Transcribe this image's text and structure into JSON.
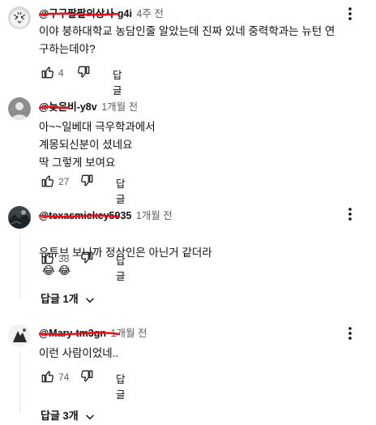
{
  "comments": [
    {
      "handle": "@구구팔팔의상사-g4i",
      "time": "4주 전",
      "text": "이야 붕하대학교 농담인줄 알았는데 진짜 있네 중력학과는 뉴턴 연\n구하는데야?",
      "likes": "4",
      "reply_label": "답글",
      "avatar_icon": "white-tiger-avatar"
    },
    {
      "handle": "@늦은비-y8v",
      "time": "1개월 전",
      "text": "아~~일베대 극우학과에서\n계몽되신분이 셨네요\n딱 그렇게 보여요",
      "likes": "27",
      "reply_label": "답글",
      "avatar_icon": "gray-person-avatar"
    },
    {
      "handle": "@texasmickey5935",
      "time": "1개월 전",
      "text": "유튜브 보니까 정상인은 아닌거 같더라",
      "emoji": "😂 😂",
      "likes": "38",
      "reply_label": "답글",
      "replies_toggle": "답글 1개",
      "avatar_icon": "dark-photo-avatar"
    },
    {
      "handle": "@Mary-tm3gn",
      "time": "1개월 전",
      "text": "이런 사람이었네..",
      "likes": "74",
      "reply_label": "답글",
      "replies_toggle": "답글 3개",
      "avatar_icon": "white-photo-avatar"
    }
  ],
  "colors": {
    "redaction": "#e8101b",
    "secondary_text": "#606060",
    "thread_line": "#e5e5e5"
  }
}
